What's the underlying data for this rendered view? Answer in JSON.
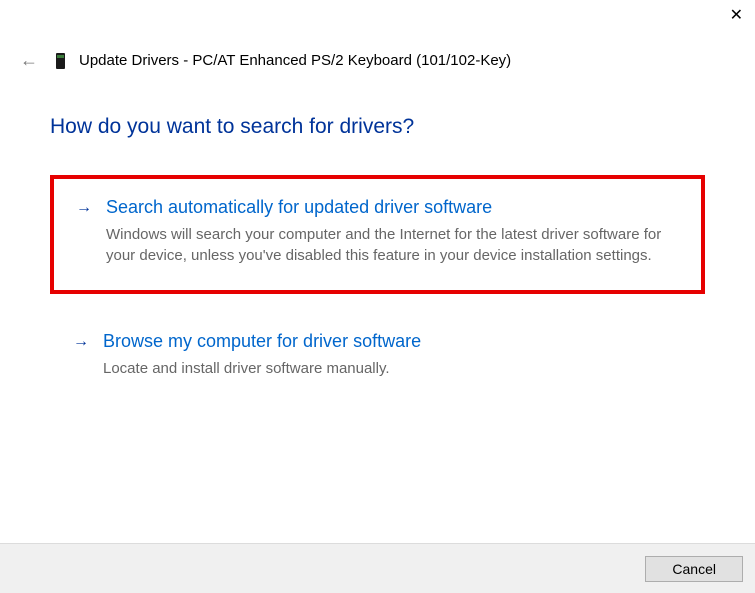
{
  "window": {
    "title": "Update Drivers - PC/AT Enhanced PS/2 Keyboard (101/102-Key)"
  },
  "heading": "How do you want to search for drivers?",
  "options": {
    "auto": {
      "title": "Search automatically for updated driver software",
      "desc": "Windows will search your computer and the Internet for the latest driver software for your device, unless you've disabled this feature in your device installation settings."
    },
    "browse": {
      "title": "Browse my computer for driver software",
      "desc": "Locate and install driver software manually."
    }
  },
  "buttons": {
    "cancel": "Cancel"
  }
}
